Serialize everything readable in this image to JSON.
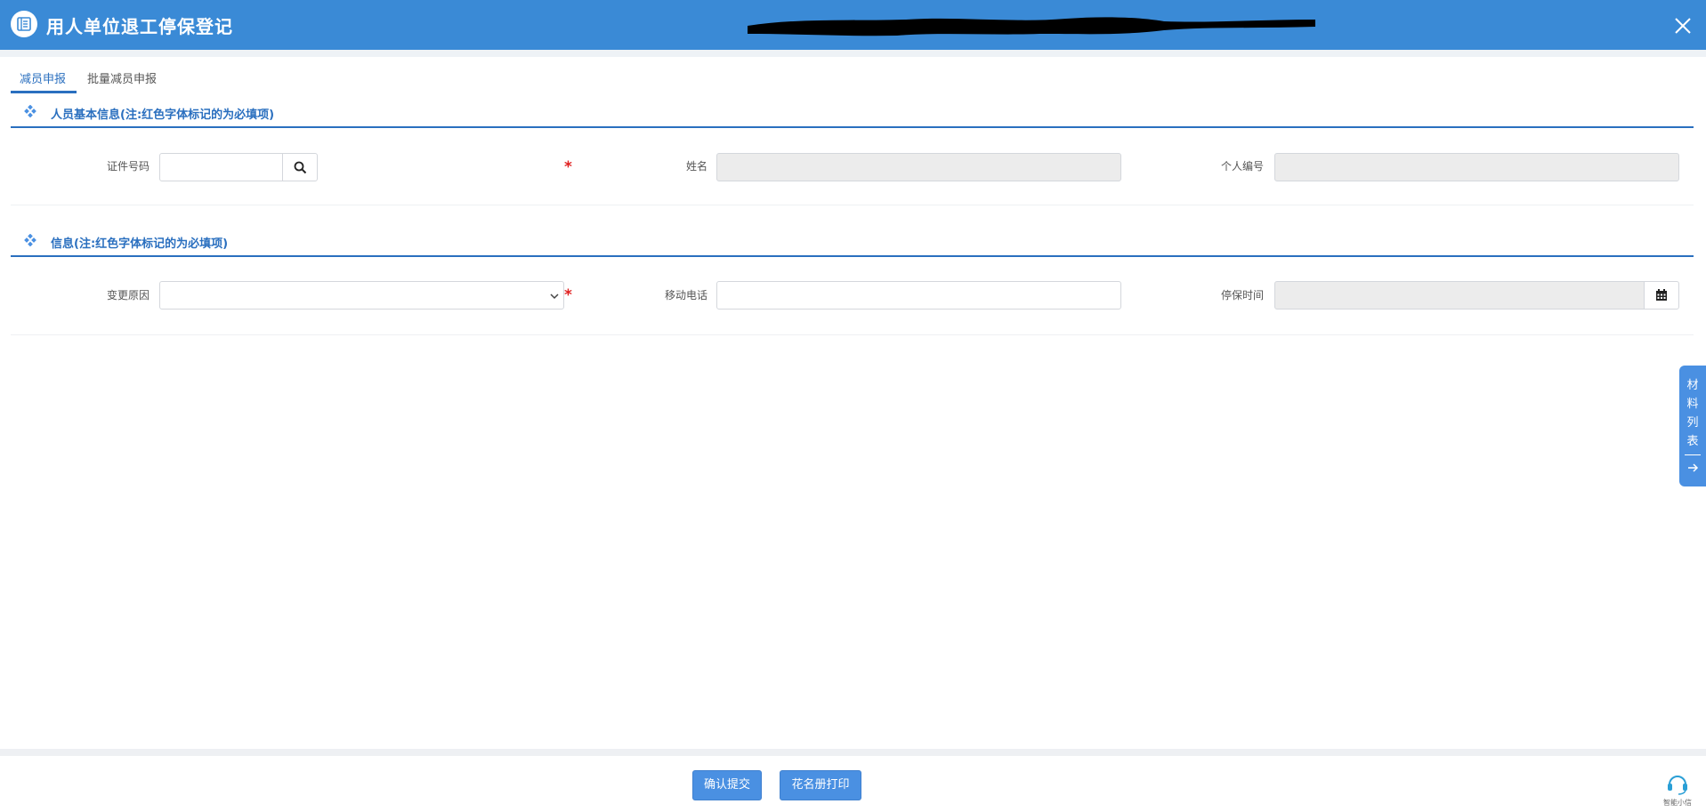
{
  "window": {
    "title": "用人单位退工停保登记"
  },
  "tabs": [
    {
      "label": "减员申报",
      "active": true
    },
    {
      "label": "批量减员申报",
      "active": false
    }
  ],
  "section1": {
    "title": "人员基本信息(注:红色字体标记的为必填项)",
    "id_label": "证件号码",
    "id_value": "",
    "name_label": "姓名",
    "name_value": "",
    "personal_no_label": "个人编号",
    "personal_no_value": ""
  },
  "section2": {
    "title": "信息(注:红色字体标记的为必填项)",
    "reason_label": "变更原因",
    "reason_selected": "",
    "mobile_label": "移动电话",
    "mobile_value": "",
    "stop_time_label": "停保时间",
    "stop_time_value": ""
  },
  "required_mark": "*",
  "side_panel": {
    "label": "材料列表"
  },
  "footer": {
    "confirm_label": "确认提交",
    "print_label": "花名册打印"
  },
  "assistant": {
    "label": "智能小信"
  },
  "colors": {
    "primary": "#3a8ad6",
    "button": "#4a90e2",
    "required": "#e02020",
    "readonly_bg": "#ececec"
  }
}
